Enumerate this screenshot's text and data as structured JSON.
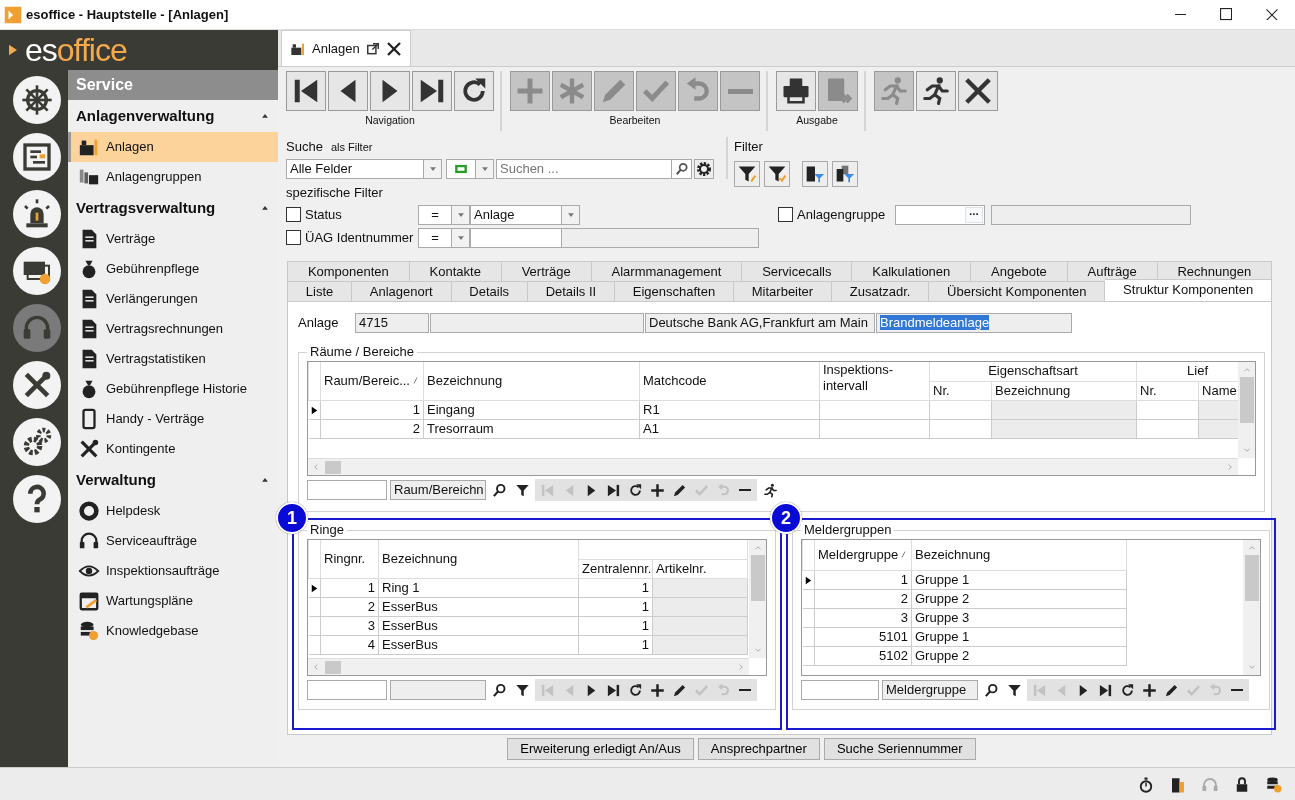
{
  "window": {
    "title": "esoffice - Hauptstelle - [Anlagen]"
  },
  "logo": {
    "first": "es",
    "second": "office"
  },
  "rail": [
    {
      "selected": false
    },
    {
      "selected": false
    },
    {
      "selected": false
    },
    {
      "selected": false
    },
    {
      "selected": true
    },
    {
      "selected": false
    },
    {
      "selected": false
    },
    {
      "selected": false
    }
  ],
  "sidebar": {
    "title": "Service",
    "sections": [
      {
        "title": "Anlagenverwaltung",
        "expanded": true,
        "items": [
          {
            "label": "Anlagen",
            "selected": true
          },
          {
            "label": "Anlagengruppen",
            "selected": false
          }
        ]
      },
      {
        "title": "Vertragsverwaltung",
        "expanded": true,
        "items": [
          {
            "label": "Verträge",
            "selected": false
          },
          {
            "label": "Gebührenpflege",
            "selected": false
          },
          {
            "label": "Verlängerungen",
            "selected": false
          },
          {
            "label": "Vertragsrechnungen",
            "selected": false
          },
          {
            "label": "Vertragstatistiken",
            "selected": false
          },
          {
            "label": "Gebührenpflege Historie",
            "selected": false
          },
          {
            "label": "Handy - Verträge",
            "selected": false
          },
          {
            "label": "Kontingente",
            "selected": false
          }
        ]
      },
      {
        "title": "Verwaltung",
        "expanded": true,
        "items": [
          {
            "label": "Helpdesk",
            "selected": false
          },
          {
            "label": "Serviceaufträge",
            "selected": false
          },
          {
            "label": "Inspektionsaufträge",
            "selected": false
          },
          {
            "label": "Wartungspläne",
            "selected": false
          },
          {
            "label": "Knowledgebase",
            "selected": false
          }
        ]
      }
    ]
  },
  "document_tab": {
    "label": "Anlagen"
  },
  "toolbar": {
    "groups": [
      {
        "label": "Navigation",
        "buttons": [
          {
            "disabled": false
          },
          {
            "disabled": false
          },
          {
            "disabled": false
          },
          {
            "disabled": false
          },
          {
            "disabled": false
          }
        ]
      },
      {
        "label": "Bearbeiten",
        "buttons": [
          {
            "disabled": true
          },
          {
            "disabled": true
          },
          {
            "disabled": true
          },
          {
            "disabled": true
          },
          {
            "disabled": true
          },
          {
            "disabled": true
          }
        ]
      },
      {
        "label": "Ausgabe",
        "buttons": [
          {
            "disabled": false
          },
          {
            "disabled": true
          }
        ]
      },
      {
        "buttons": [
          {
            "disabled": true
          },
          {
            "disabled": false
          },
          {
            "disabled": false
          }
        ]
      }
    ]
  },
  "search": {
    "label": "Suche",
    "mode": "als Filter",
    "field": "Alle Felder",
    "placeholder": "Suchen ..."
  },
  "filter": {
    "label": "Filter"
  },
  "specific_filters": {
    "label": "spezifische Filter",
    "rows": [
      {
        "label": "Status",
        "checked": false,
        "operator": "=",
        "value": "Anlage"
      },
      {
        "label": "ÜAG Identnummer",
        "checked": false,
        "operator": "="
      }
    ],
    "group": {
      "label": "Anlagengruppe",
      "checked": false,
      "button": "···"
    }
  },
  "tabs": [
    [
      {
        "label": "Komponenten",
        "selected": false
      },
      {
        "label": "Kontakte",
        "selected": false
      },
      {
        "label": "Verträge",
        "selected": false
      },
      {
        "label": "Alarmmanagement",
        "selected": false
      },
      {
        "label": "Servicecalls",
        "selected": false
      },
      {
        "label": "Kalkulationen",
        "selected": false
      },
      {
        "label": "Angebote",
        "selected": false
      },
      {
        "label": "Aufträge",
        "selected": false
      },
      {
        "label": "Rechnungen",
        "selected": false
      }
    ],
    [
      {
        "label": "Liste",
        "selected": false
      },
      {
        "label": "Anlagenort",
        "selected": false
      },
      {
        "label": "Details",
        "selected": false
      },
      {
        "label": "Details II",
        "selected": false
      },
      {
        "label": "Eigenschaften",
        "selected": false
      },
      {
        "label": "Mitarbeiter",
        "selected": false
      },
      {
        "label": "Zusatzadr.",
        "selected": false
      },
      {
        "label": "Übersicht Komponenten",
        "selected": false
      },
      {
        "label": "Struktur Komponenten",
        "selected": true
      }
    ]
  ],
  "anlage": {
    "label": "Anlage",
    "fields": [
      {
        "value": "4715",
        "highlighted": false
      },
      {
        "value": "Deutsche Bank AG,Frankfurt am Main",
        "highlighted": false
      },
      {
        "value": "Brandmeldeanlage",
        "highlighted": true
      }
    ]
  },
  "rooms": {
    "title": "Räume / Bereiche",
    "columns": [
      {
        "label": "Raum/Bereic...",
        "sorted": true,
        "numeric": true
      },
      {
        "label": "Bezeichnung"
      },
      {
        "label": "Matchcode"
      },
      {
        "label": "Inspektions-intervall"
      },
      {
        "label": "Eigenschaftsart",
        "sub": [
          {
            "label": "Nr."
          },
          {
            "label": "Bezeichnung",
            "readonly": true
          }
        ]
      },
      {
        "label": "Lief",
        "sub": [
          {
            "label": "Nr."
          },
          {
            "label": "Name",
            "readonly": true
          }
        ]
      }
    ],
    "rows": [
      {
        "current": true,
        "cells": [
          "1",
          "Eingang",
          "R1"
        ]
      },
      {
        "current": false,
        "cells": [
          "2",
          "Tresorraum",
          "A1"
        ]
      }
    ],
    "navigator": {
      "field": "Raum/Bereichn",
      "buttons": [
        {
          "disabled": false
        },
        {
          "disabled": false
        },
        {
          "disabled": true
        },
        {
          "disabled": true
        },
        {
          "disabled": false
        },
        {
          "disabled": false
        },
        {
          "disabled": false
        },
        {
          "disabled": false
        },
        {
          "disabled": false
        },
        {
          "disabled": true
        },
        {
          "disabled": true
        },
        {
          "disabled": false
        },
        {
          "disabled": false
        }
      ]
    }
  },
  "rings": {
    "callout": "1",
    "title": "Ringe",
    "columns": [
      {
        "label": "Ringnr.",
        "numeric": true
      },
      {
        "label": "Bezeichnung"
      },
      {
        "sub": [
          {
            "label": "Zentralennr.",
            "numeric": true
          },
          {
            "label": "Artikelnr.",
            "readonly": true
          }
        ]
      }
    ],
    "rows": [
      {
        "current": true,
        "cells": [
          "1",
          "Ring 1",
          "1"
        ]
      },
      {
        "current": false,
        "cells": [
          "2",
          "EsserBus",
          "1"
        ]
      },
      {
        "current": false,
        "cells": [
          "3",
          "EsserBus",
          "1"
        ]
      },
      {
        "current": false,
        "cells": [
          "4",
          "EsserBus",
          "1"
        ]
      }
    ],
    "navigator": {
      "buttons": [
        {
          "disabled": false
        },
        {
          "disabled": false
        },
        {
          "disabled": true
        },
        {
          "disabled": true
        },
        {
          "disabled": false
        },
        {
          "disabled": false
        },
        {
          "disabled": false
        },
        {
          "disabled": false
        },
        {
          "disabled": false
        },
        {
          "disabled": true
        },
        {
          "disabled": true
        },
        {
          "disabled": false
        }
      ]
    }
  },
  "detector_groups": {
    "callout": "2",
    "title": "Meldergruppen",
    "columns": [
      {
        "label": "Meldergruppe",
        "sorted": true,
        "numeric": true
      },
      {
        "label": "Bezeichnung"
      }
    ],
    "rows": [
      {
        "current": true,
        "cells": [
          "1",
          "Gruppe 1"
        ]
      },
      {
        "current": false,
        "cells": [
          "2",
          "Gruppe 2"
        ]
      },
      {
        "current": false,
        "cells": [
          "3",
          "Gruppe 3"
        ]
      },
      {
        "current": false,
        "cells": [
          "5101",
          "Gruppe 1"
        ]
      },
      {
        "current": false,
        "cells": [
          "5102",
          "Gruppe 2"
        ]
      }
    ],
    "navigator": {
      "field": "Meldergruppe",
      "buttons": [
        {
          "disabled": false
        },
        {
          "disabled": false
        },
        {
          "disabled": true
        },
        {
          "disabled": true
        },
        {
          "disabled": false
        },
        {
          "disabled": false
        },
        {
          "disabled": false
        },
        {
          "disabled": false
        },
        {
          "disabled": false
        },
        {
          "disabled": true
        },
        {
          "disabled": true
        },
        {
          "disabled": false
        }
      ]
    }
  },
  "buttons": [
    "Erweiterung erledigt An/Aus",
    "Ansprechpartner",
    "Suche Seriennummer"
  ],
  "status_bar": {
    "icons": [
      {
        "disabled": false
      },
      {
        "disabled": false
      },
      {
        "disabled": true
      },
      {
        "disabled": false
      },
      {
        "disabled": false
      }
    ]
  }
}
